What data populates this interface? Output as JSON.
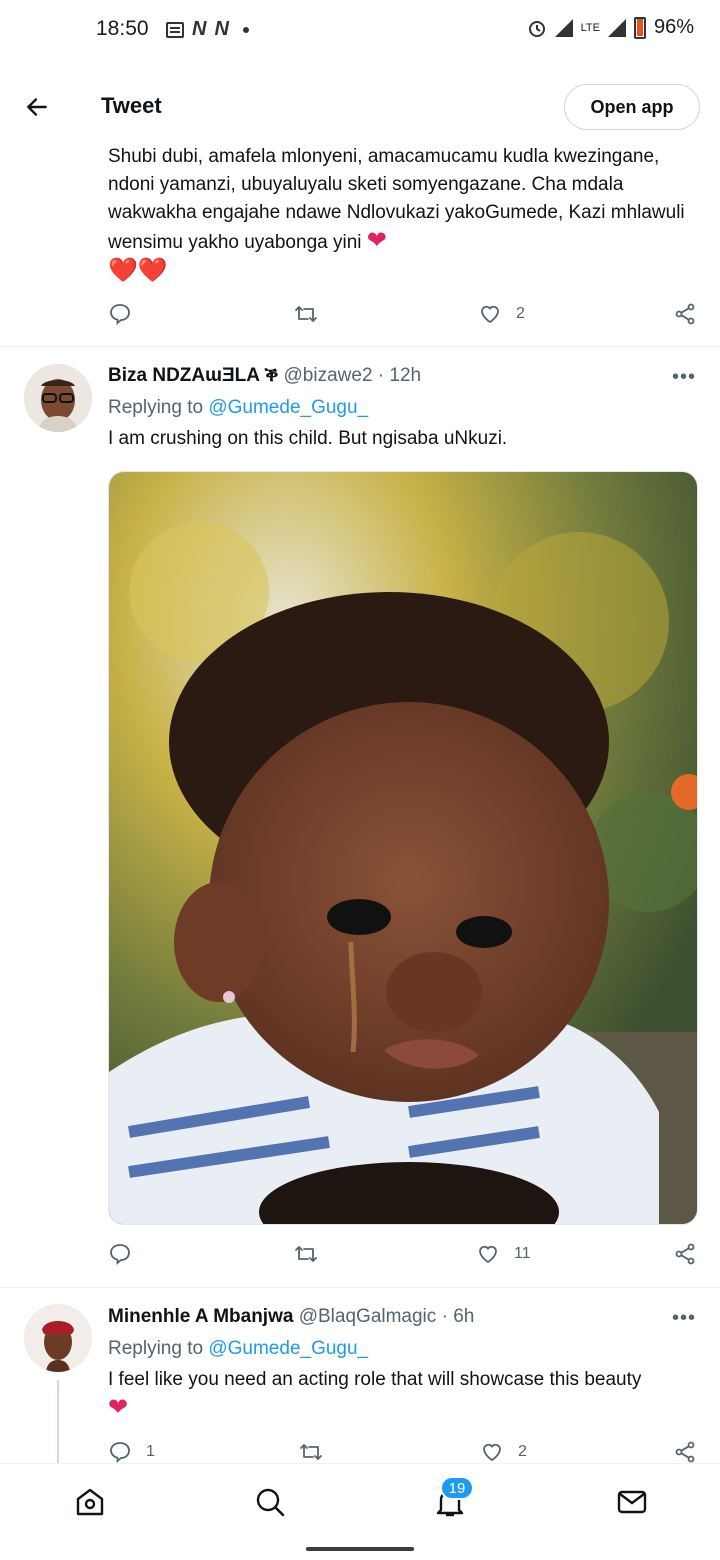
{
  "status_bar": {
    "time": "18:50",
    "battery": "96%",
    "network": "LTE"
  },
  "header": {
    "title": "Tweet",
    "open_app": "Open app"
  },
  "tweet1": {
    "text": "Shubi dubi, amafela mlonyeni, amacamucamu kudla kwezingane, ndoni yamanzi, ubuyaluyalu sketi somyengazane. Cha mdala wakwakha engajahe ndawe Ndlovukazi yakoGumede, Kazi mhlawuli wensimu yakho uyabonga yini",
    "hearts": "❤️❤️",
    "likes": "2"
  },
  "tweet2": {
    "name": "Biza NDZAɯƎLA ቕ",
    "handle": "@bizawe2",
    "time": "12h",
    "replying_label": "Replying to",
    "replying_to": "@Gumede_Gugu_",
    "text": "I am crushing on this child. But ngisaba uNkuzi.",
    "likes": "11"
  },
  "tweet3": {
    "name": "Minenhle A Mbanjwa",
    "handle": "@BlaqGalmagic",
    "time": "6h",
    "replying_label": "Replying to",
    "replying_to": "@Gumede_Gugu_",
    "text": "I feel like you need an acting role that will showcase this beauty",
    "heart": "❤",
    "replies": "1",
    "likes": "2"
  },
  "bottom_nav": {
    "notifications_badge": "19"
  },
  "icons": [
    "back-arrow-icon",
    "reply-icon",
    "retweet-icon",
    "like-icon",
    "share-icon",
    "home-icon",
    "search-icon",
    "notifications-icon",
    "messages-icon"
  ],
  "colors": {
    "accent": "#1d9bf0",
    "heart": "#e0245e",
    "muted": "#536471"
  }
}
